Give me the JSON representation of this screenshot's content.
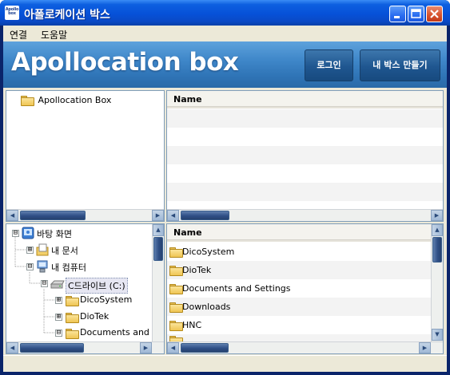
{
  "window": {
    "title": "아폴로케이션 박스",
    "icon_text": "Apollo box",
    "controls": [
      "minimize",
      "maximize",
      "close"
    ],
    "accent": "#0a5ad8",
    "close_color": "#d9552f"
  },
  "menu": {
    "items": [
      "연결",
      "도움말"
    ]
  },
  "banner": {
    "title": "Apollocation box",
    "login_label": "로그인",
    "make_box_label": "내 박스 만들기",
    "color": "#3f87c9"
  },
  "top_tree": {
    "root_label": "Apollocation Box",
    "root_icon": "folder-icon"
  },
  "top_list": {
    "column_header": "Name",
    "items": []
  },
  "bottom_tree": {
    "nodes": [
      {
        "label": "바탕 화면",
        "icon": "desktop-icon",
        "expander": "⊟"
      },
      {
        "label": "내 문서",
        "icon": "my-documents-icon",
        "expander": "⊞"
      },
      {
        "label": "내 컴퓨터",
        "icon": "my-computer-icon",
        "expander": "⊟"
      },
      {
        "label": "C드라이브 (C:)",
        "icon": "drive-icon",
        "expander": "⊟",
        "selected": true
      },
      {
        "label": "DicoSystem",
        "icon": "folder-icon",
        "expander": "⊞"
      },
      {
        "label": "DioTek",
        "icon": "folder-icon",
        "expander": "⊞"
      },
      {
        "label": "Documents and",
        "icon": "folder-icon",
        "expander": "⊟"
      }
    ]
  },
  "bottom_list": {
    "column_header": "Name",
    "items": [
      "DicoSystem",
      "DioTek",
      "Documents and Settings",
      "Downloads",
      "HNC"
    ]
  },
  "scroll_arrows": {
    "left": "◀",
    "right": "▶",
    "up": "▲",
    "down": "▼"
  }
}
